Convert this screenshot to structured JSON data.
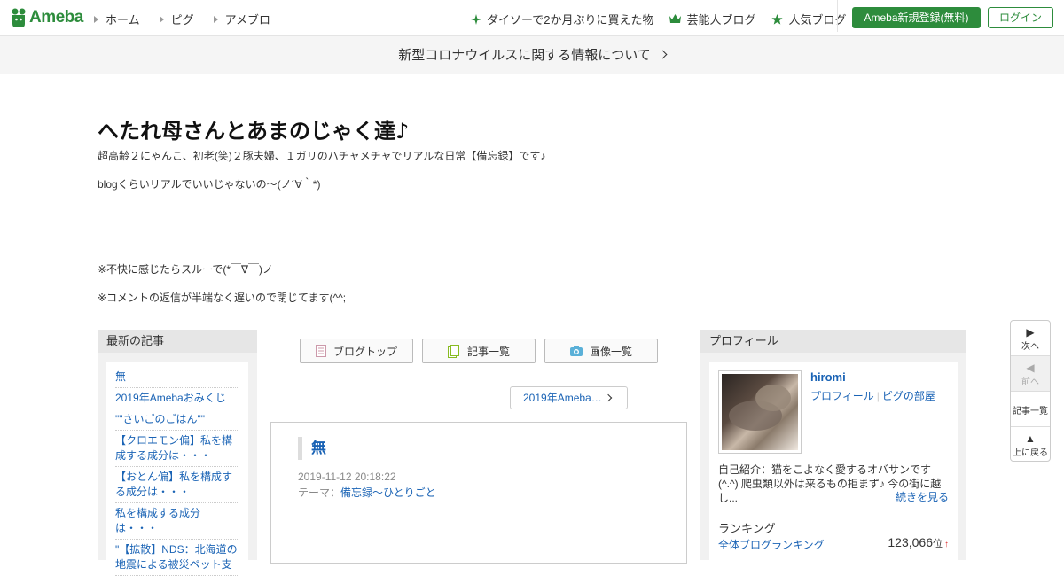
{
  "header": {
    "logo": "Ameba",
    "nav": [
      "ホーム",
      "ピグ",
      "アメブロ"
    ],
    "links": [
      {
        "label": "ダイソーで2か月ぶりに買えた物",
        "icon": "sparkle-icon"
      },
      {
        "label": "芸能人ブログ",
        "icon": "crown-icon"
      },
      {
        "label": "人気ブログ",
        "icon": "star-icon"
      }
    ],
    "register": "Ameba新規登録(無料)",
    "login": "ログイン"
  },
  "notice": "新型コロナウイルスに関する情報について",
  "blog": {
    "title": "へたれ母さんとあまのじゃく達♪",
    "desc1": "超高齢２にゃんこ、初老(笑)２豚夫婦、１ガリのハチャメチャでリアルな日常【備忘録】です♪",
    "desc2": "blogくらいリアルでいいじゃないの～(ノ´∀｀*)",
    "desc3": "※不快に感じたらスルーで(*￣∇￣)ノ",
    "desc4": "※コメントの返信が半端なく遅いので閉じてます(^^;"
  },
  "sidebar_left": {
    "heading": "最新の記事",
    "items": [
      "無",
      "2019年Amebaおみくじ",
      "\"\"さいごのごはん\"\"",
      "【クロエモン偏】私を構成する成分は・・・",
      "【おとん偏】私を構成する成分は・・・",
      "私を構成する成分は・・・",
      "\"【拡散】NDS：北海道の地震による被災ペット支"
    ]
  },
  "center": {
    "buttons": [
      {
        "label": "ブログトップ",
        "icon": "blog-top-icon"
      },
      {
        "label": "記事一覧",
        "icon": "articles-icon"
      },
      {
        "label": "画像一覧",
        "icon": "camera-icon"
      }
    ],
    "pager": "2019年Ameba…",
    "article": {
      "title": "無",
      "date": "2019-11-12 20:18:22",
      "theme_label": "テーマ：",
      "theme": "備忘録～ひとりごと"
    }
  },
  "sidebar_right": {
    "heading": "プロフィール",
    "name": "hiromi",
    "link1": "プロフィール",
    "link_sep": "|",
    "link2": "ピグの部屋",
    "intro": "自己紹介：猫をこよなく愛するオバサンです(^.^) 爬虫類以外は来るもの拒まず♪ 今の街に越し...",
    "more": "続きを見る",
    "ranking_heading": "ランキング",
    "ranking_label": "全体ブログランキング",
    "ranking_value": "123,066",
    "ranking_unit": "位",
    "ranking_arrow": "↑"
  },
  "float_nav": [
    {
      "glyph": "▶",
      "label": "次へ"
    },
    {
      "glyph": "◀",
      "label": "前へ"
    },
    {
      "glyph": "",
      "label": "記事一覧"
    },
    {
      "glyph": "▲",
      "label": "上に戻る"
    }
  ],
  "colors": {
    "brand": "#2d8c3c",
    "link": "#1a63b5"
  }
}
